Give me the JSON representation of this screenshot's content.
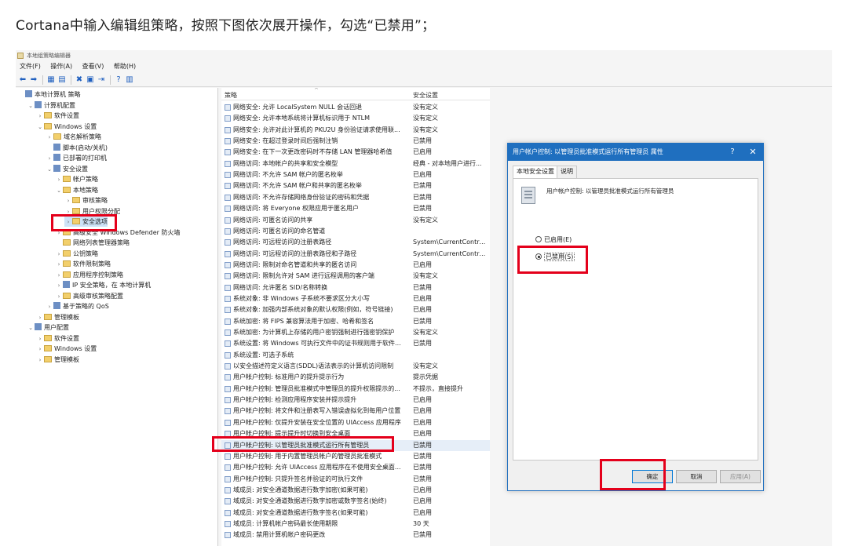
{
  "caption": "Cortana中输入编辑组策略，按照下图依次展开操作，勾选“已禁用”；",
  "window": {
    "title": "本地组策略编辑器",
    "menu": [
      "文件(F)",
      "操作(A)",
      "查看(V)",
      "帮助(H)"
    ]
  },
  "toolbar": {
    "icons": [
      "back-icon",
      "forward-icon",
      "up-folder-icon",
      "show-hide-tree-icon",
      "delete-icon",
      "properties-icon",
      "export-icon",
      "help-icon",
      "view-icon"
    ],
    "glyphs": [
      "⬅",
      "➡",
      "▦",
      "▤",
      "✖",
      "▣",
      "⇥",
      "?",
      "▥"
    ]
  },
  "tree": [
    {
      "label": "本地计算机 策略",
      "depth": 0,
      "arrow": "",
      "icon": "node"
    },
    {
      "label": "计算机配置",
      "depth": 1,
      "arrow": "⌄",
      "icon": "node"
    },
    {
      "label": "软件设置",
      "depth": 2,
      "arrow": "›",
      "icon": "folder"
    },
    {
      "label": "Windows 设置",
      "depth": 2,
      "arrow": "⌄",
      "icon": "folder"
    },
    {
      "label": "域名解析策略",
      "depth": 3,
      "arrow": "›",
      "icon": "folder"
    },
    {
      "label": "脚本(启动/关机)",
      "depth": 3,
      "arrow": "",
      "icon": "node"
    },
    {
      "label": "已部署的打印机",
      "depth": 3,
      "arrow": "›",
      "icon": "node"
    },
    {
      "label": "安全设置",
      "depth": 3,
      "arrow": "⌄",
      "icon": "node"
    },
    {
      "label": "帐户策略",
      "depth": 4,
      "arrow": "›",
      "icon": "folder"
    },
    {
      "label": "本地策略",
      "depth": 4,
      "arrow": "⌄",
      "icon": "folder"
    },
    {
      "label": "审核策略",
      "depth": 5,
      "arrow": "›",
      "icon": "folder"
    },
    {
      "label": "用户权限分配",
      "depth": 5,
      "arrow": "›",
      "icon": "folder"
    },
    {
      "label": "安全选项",
      "depth": 5,
      "arrow": "›",
      "icon": "folder",
      "selected": true
    },
    {
      "label": "高级安全 Windows Defender 防火墙",
      "depth": 4,
      "arrow": "›",
      "icon": "folder"
    },
    {
      "label": "网络列表管理器策略",
      "depth": 4,
      "arrow": "",
      "icon": "folder"
    },
    {
      "label": "公钥策略",
      "depth": 4,
      "arrow": "›",
      "icon": "folder"
    },
    {
      "label": "软件限制策略",
      "depth": 4,
      "arrow": "›",
      "icon": "folder"
    },
    {
      "label": "应用程序控制策略",
      "depth": 4,
      "arrow": "›",
      "icon": "folder"
    },
    {
      "label": "IP 安全策略，在 本地计算机",
      "depth": 4,
      "arrow": "›",
      "icon": "node"
    },
    {
      "label": "高级审核策略配置",
      "depth": 4,
      "arrow": "›",
      "icon": "folder"
    },
    {
      "label": "基于策略的 QoS",
      "depth": 3,
      "arrow": "›",
      "icon": "node"
    },
    {
      "label": "管理模板",
      "depth": 2,
      "arrow": "›",
      "icon": "folder"
    },
    {
      "label": "用户配置",
      "depth": 1,
      "arrow": "⌄",
      "icon": "node"
    },
    {
      "label": "软件设置",
      "depth": 2,
      "arrow": "›",
      "icon": "folder"
    },
    {
      "label": "Windows 设置",
      "depth": 2,
      "arrow": "›",
      "icon": "folder"
    },
    {
      "label": "管理模板",
      "depth": 2,
      "arrow": "›",
      "icon": "folder"
    }
  ],
  "list": {
    "col_policy": "策略",
    "col_setting": "安全设置",
    "sort_glyph": "^",
    "rows": [
      {
        "name": "网络安全: 允许 LocalSystem NULL 会话回退",
        "value": "没有定义"
      },
      {
        "name": "网络安全: 允许本地系统将计算机标识用于 NTLM",
        "value": "没有定义"
      },
      {
        "name": "网络安全: 允许对此计算机的 PKU2U 身份验证请求使用联...",
        "value": "没有定义"
      },
      {
        "name": "网络安全: 在超过登录时间后强制注销",
        "value": "已禁用"
      },
      {
        "name": "网络安全: 在下一次更改密码时不存储 LAN 管理器哈希值",
        "value": "已启用"
      },
      {
        "name": "网络访问: 本地帐户的共享和安全模型",
        "value": "经典 - 对本地用户进行..."
      },
      {
        "name": "网络访问: 不允许 SAM 帐户的匿名枚举",
        "value": "已启用"
      },
      {
        "name": "网络访问: 不允许 SAM 帐户和共享的匿名枚举",
        "value": "已禁用"
      },
      {
        "name": "网络访问: 不允许存储网络身份验证的密码和凭据",
        "value": "已禁用"
      },
      {
        "name": "网络访问: 将 Everyone 权限应用于匿名用户",
        "value": "已禁用"
      },
      {
        "name": "网络访问: 可匿名访问的共享",
        "value": "没有定义"
      },
      {
        "name": "网络访问: 可匿名访问的命名管道",
        "value": ""
      },
      {
        "name": "网络访问: 可远程访问的注册表路径",
        "value": "System\\CurrentContro..."
      },
      {
        "name": "网络访问: 可远程访问的注册表路径和子路径",
        "value": "System\\CurrentContro..."
      },
      {
        "name": "网络访问: 限制对命名管道和共享的匿名访问",
        "value": "已启用"
      },
      {
        "name": "网络访问: 限制允许对 SAM 进行远程调用的客户端",
        "value": "没有定义"
      },
      {
        "name": "网络访问: 允许匿名 SID/名称转换",
        "value": "已禁用"
      },
      {
        "name": "系统对象: 非 Windows 子系统不要求区分大小写",
        "value": "已启用"
      },
      {
        "name": "系统对象: 加强内部系统对象的默认权限(例如，符号链接)",
        "value": "已启用"
      },
      {
        "name": "系统加密: 将 FIPS 兼容算法用于加密、哈希和签名",
        "value": "已禁用"
      },
      {
        "name": "系统加密: 为计算机上存储的用户密钥强制进行强密钥保护",
        "value": "没有定义"
      },
      {
        "name": "系统设置: 将 Windows 可执行文件中的证书规则用于软件...",
        "value": "已禁用"
      },
      {
        "name": "系统设置: 可选子系统",
        "value": ""
      },
      {
        "name": "以安全描述符定义语言(SDDL)语法表示的计算机访问限制",
        "value": "没有定义"
      },
      {
        "name": "用户帐户控制: 标准用户的提升提示行为",
        "value": "提示凭据"
      },
      {
        "name": "用户帐户控制: 管理员批准模式中管理员的提升权限提示的...",
        "value": "不提示，直接提升"
      },
      {
        "name": "用户帐户控制: 检测应用程序安装并提示提升",
        "value": "已启用"
      },
      {
        "name": "用户帐户控制: 将文件和注册表写入错误虚拟化到每用户位置",
        "value": "已启用"
      },
      {
        "name": "用户帐户控制: 仅提升安装在安全位置的 UIAccess 应用程序",
        "value": "已启用"
      },
      {
        "name": "用户帐户控制: 提示提升时切换到安全桌面",
        "value": "已启用"
      },
      {
        "name": "用户帐户控制: 以管理员批准模式运行所有管理员",
        "value": "已禁用",
        "selected": true
      },
      {
        "name": "用户帐户控制: 用于内置管理员帐户的管理员批准模式",
        "value": "已禁用"
      },
      {
        "name": "用户帐户控制: 允许 UIAccess 应用程序在不使用安全桌面...",
        "value": "已禁用"
      },
      {
        "name": "用户帐户控制: 只提升签名并验证的可执行文件",
        "value": "已禁用"
      },
      {
        "name": "域成员: 对安全通道数据进行数字加密(如果可能)",
        "value": "已启用"
      },
      {
        "name": "域成员: 对安全通道数据进行数字加密或数字签名(始终)",
        "value": "已启用"
      },
      {
        "name": "域成员: 对安全通道数据进行数字签名(如果可能)",
        "value": "已启用"
      },
      {
        "name": "域成员: 计算机帐户密码最长使用期限",
        "value": "30 天"
      },
      {
        "name": "域成员: 禁用计算机帐户密码更改",
        "value": "已禁用"
      }
    ]
  },
  "dialog": {
    "title": "用户帐户控制: 以管理员批准模式运行所有管理员 属性",
    "help_glyph": "?",
    "close_glyph": "✕",
    "tabs": [
      "本地安全设置",
      "说明"
    ],
    "policy_name": "用户帐户控制: 以管理员批准模式运行所有管理员",
    "radio_enabled": "已启用(E)",
    "radio_disabled": "已禁用(S)",
    "selected": "disabled",
    "ok": "确定",
    "cancel": "取消",
    "apply": "应用(A)"
  }
}
